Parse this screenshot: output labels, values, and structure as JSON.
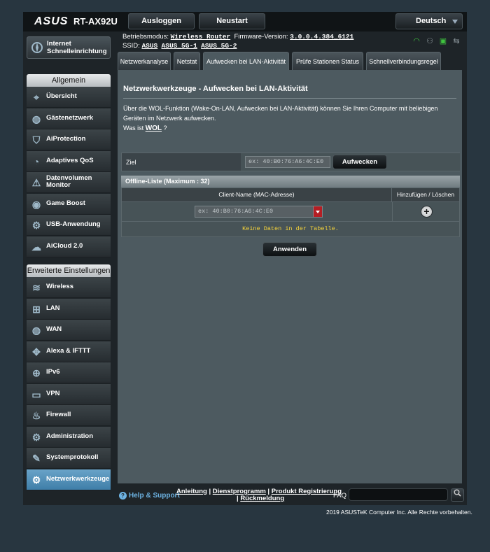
{
  "header": {
    "brand": "ASUS",
    "model": "RT-AX92U",
    "logout_label": "Ausloggen",
    "restart_label": "Neustart",
    "language": "Deutsch"
  },
  "info": {
    "mode_label": "Betriebsmodus:",
    "mode_value": "Wireless Router",
    "firmware_label": "Firmware-Version:",
    "firmware_value": "3.0.0.4.384_6121",
    "ssid_label": "SSID:",
    "ssids": [
      "ASUS",
      "ASUS_5G-1",
      "ASUS_5G-2"
    ]
  },
  "sidebar": {
    "qis_label": "Internet Schnelleinrichtung",
    "general_header": "Allgemein",
    "general_items": [
      {
        "label": "Übersicht",
        "icon": "map-icon"
      },
      {
        "label": "Gästenetzwerk",
        "icon": "globe-icon"
      },
      {
        "label": "AiProtection",
        "icon": "shield-icon"
      },
      {
        "label": "Adaptives QoS",
        "icon": "gauge-icon"
      },
      {
        "label": "Datenvolumen Monitor",
        "icon": "traffic-icon"
      },
      {
        "label": "Game Boost",
        "icon": "gamepad-icon"
      },
      {
        "label": "USB-Anwendung",
        "icon": "usb-icon"
      },
      {
        "label": "AiCloud 2.0",
        "icon": "cloud-icon"
      }
    ],
    "advanced_header": "Erweiterte Einstellungen",
    "advanced_items": [
      {
        "label": "Wireless",
        "icon": "wifi-icon"
      },
      {
        "label": "LAN",
        "icon": "lan-icon"
      },
      {
        "label": "WAN",
        "icon": "globe-icon"
      },
      {
        "label": "Alexa & IFTTT",
        "icon": "alexa-icon"
      },
      {
        "label": "IPv6",
        "icon": "ipv6-icon"
      },
      {
        "label": "VPN",
        "icon": "vpn-icon"
      },
      {
        "label": "Firewall",
        "icon": "fire-icon"
      },
      {
        "label": "Administration",
        "icon": "admin-gear-icon"
      },
      {
        "label": "Systemprotokoll",
        "icon": "log-icon"
      },
      {
        "label": "Netzwerkwerkzeuge",
        "icon": "tools-gear-icon"
      }
    ]
  },
  "tabs": [
    "Netzwerkanalyse",
    "Netstat",
    "Aufwecken bei LAN-Aktivität",
    "Prüfe Stationen Status",
    "Schnellverbindungsregel"
  ],
  "content": {
    "title": "Netzwerkwerkzeuge - Aufwecken bei LAN-Aktivität",
    "description": "Über die WOL-Funktion (Wake-On-LAN, Aufwecken bei LAN-Aktivität) können Sie Ihren Computer mit beliebigen Geräten im Netzwerk aufwecken.",
    "whatis_prefix": "Was ist",
    "whatis_link": "WOL",
    "whatis_suffix": "?",
    "target_label": "Ziel",
    "target_placeholder": "ex: 40:B0:76:A6:4C:E0",
    "wake_button": "Aufwecken",
    "offline_header": "Offline-Liste (Maximum : 32)",
    "col_client": "Client-Name (MAC-Adresse)",
    "col_action": "Hinzufügen / Löschen",
    "client_placeholder": "ex: 40:B0:76:A6:4C:E0",
    "add_symbol": "+",
    "no_data": "Keine Daten in der Tabelle.",
    "apply_button": "Anwenden"
  },
  "footer": {
    "help": "Help & Support",
    "link1": "Anleitung",
    "link2": "Dienstprogramm",
    "link3": "Produkt Registrierung",
    "link4": "Rückmeldung",
    "sep": "|",
    "faq": "FAQ",
    "copyright": "2019 ASUSTeK Computer Inc. Alle Rechte vorbehalten."
  }
}
